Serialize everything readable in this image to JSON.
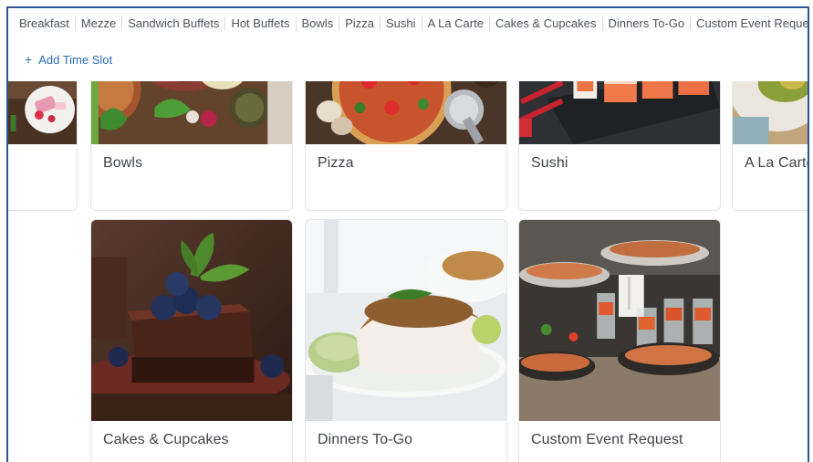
{
  "tabs": [
    "Breakfast",
    "Mezze",
    "Sandwich Buffets",
    "Hot Buffets",
    "Bowls",
    "Pizza",
    "Sushi",
    "A La Carte",
    "Cakes & Cupcakes",
    "Dinners To-Go",
    "Custom Event Request"
  ],
  "add_time_slot": {
    "icon": "+",
    "label": "Add Time Slot"
  },
  "cards_row1": [
    {
      "label": ""
    },
    {
      "label": "Bowls"
    },
    {
      "label": "Pizza"
    },
    {
      "label": "Sushi"
    },
    {
      "label": "A La Carte"
    }
  ],
  "cards_row2": [
    {
      "label": "Cakes & Cupcakes"
    },
    {
      "label": "Dinners To-Go"
    },
    {
      "label": "Custom Event Request"
    }
  ],
  "colors": {
    "frame_border": "#2b5797",
    "link": "#2e6bb3",
    "tab_text": "#4d5259"
  }
}
